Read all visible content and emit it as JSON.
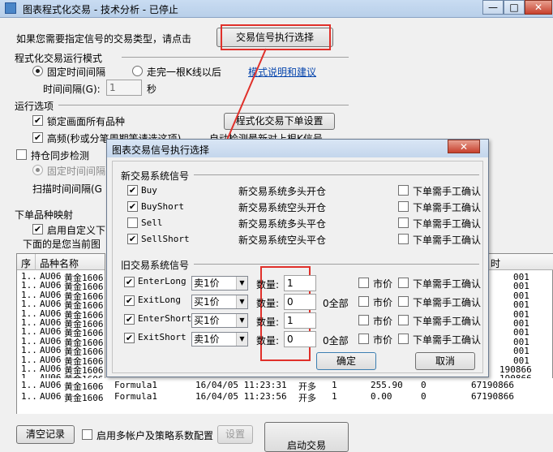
{
  "window": {
    "title": "图表程式化交易 - 技术分析 - 已停止",
    "min": "—",
    "max": "□",
    "close": "✕"
  },
  "signal_type": {
    "prompt": "如果您需要指定信号的交易类型，请点击",
    "button": "交易信号执行选择"
  },
  "run_mode": {
    "title": "程式化交易运行模式",
    "fixed": "固定时间间隔",
    "after_k": "走完一根K线以后",
    "interval_label": "时间间隔(G):",
    "interval_value": "1",
    "unit": "秒",
    "link": "模式说明和建议"
  },
  "run_options": {
    "title": "运行选项",
    "lock": "锁定画面所有品种",
    "setup_button": "程式化交易下单设置",
    "hf": "高频(秒或分笔周期等请选这项)",
    "auto": "自动检测最新对上根K信号",
    "sync": "持仓同步检测",
    "fixed": "固定时间间隔",
    "scan": "扫描时间间隔(G"
  },
  "mapping": {
    "title": "下单品种映射",
    "custom": "启用自定义下",
    "below": "下面的是您当前图"
  },
  "table": {
    "headers": [
      "序",
      "品种名称",
      "",
      "",
      "",
      "",
      "",
      "",
      "",
      "时"
    ],
    "head_right": "时",
    "rows": [
      {
        "n": "1..",
        "code": "AU06",
        "name": "黄金1606",
        "tail": "001"
      },
      {
        "n": "1..",
        "code": "AU06",
        "name": "黄金1606",
        "tail": "001"
      },
      {
        "n": "1..",
        "code": "AU06",
        "name": "黄金1606",
        "tail": "001"
      },
      {
        "n": "1..",
        "code": "AU06",
        "name": "黄金1606",
        "tail": "001"
      },
      {
        "n": "1..",
        "code": "AU06",
        "name": "黄金1606",
        "tail": "001"
      },
      {
        "n": "1..",
        "code": "AU06",
        "name": "黄金1606",
        "tail": "001"
      },
      {
        "n": "1..",
        "code": "AU06",
        "name": "黄金1606",
        "tail": "001"
      },
      {
        "n": "1..",
        "code": "AU06",
        "name": "黄金1606",
        "tail": "001"
      },
      {
        "n": "1..",
        "code": "AU06",
        "name": "黄金1606",
        "tail": "001"
      },
      {
        "n": "1..",
        "code": "AU06",
        "name": "黄金1606",
        "tail": "001"
      },
      {
        "n": "1..",
        "code": "AU06",
        "name": "黄金1606",
        "tail": "190866"
      },
      {
        "n": "1..",
        "code": "AU06",
        "name": "黄金1606",
        "tail": "190866"
      },
      {
        "n": "1..",
        "code": "AU06",
        "name": "黄金1606",
        "tail": "67190866"
      }
    ],
    "full_rows": [
      {
        "n": "1..",
        "code": "AU06",
        "name": "黄金1606",
        "formula": "Formula1",
        "time": "16/04/05 11:23:31",
        "act": "开多",
        "qty": "1",
        "price": "255.90",
        "z": "0",
        "acct": "67190866"
      },
      {
        "n": "1..",
        "code": "AU06",
        "name": "黄金1606",
        "formula": "Formula1",
        "time": "16/04/05 11:23:56",
        "act": "开多",
        "qty": "1",
        "price": "0.00",
        "z": "0",
        "acct": "67190866"
      }
    ],
    "row_prefix": ""
  },
  "bottom": {
    "clear": "清空记录",
    "multi": "启用多帐户及策略系数配置",
    "settings": "设置",
    "start": "启动交易"
  },
  "dialog": {
    "title": "图表交易信号执行选择",
    "close": "✕",
    "new_title": "新交易系统信号",
    "new_signals": [
      {
        "name": "Buy",
        "checked": true,
        "desc": "新交易系统多头开仓",
        "manual": "下单需手工确认"
      },
      {
        "name": "BuyShort",
        "checked": true,
        "desc": "新交易系统空头开仓",
        "manual": "下单需手工确认"
      },
      {
        "name": "Sell",
        "checked": false,
        "desc": "新交易系统多头平仓",
        "manual": "下单需手工确认"
      },
      {
        "name": "SellShort",
        "checked": true,
        "desc": "新交易系统空头平仓",
        "manual": "下单需手工确认"
      }
    ],
    "old_title": "旧交易系统信号",
    "old_signals": [
      {
        "name": "EnterLong",
        "price": "卖1价",
        "qty_label": "数量:",
        "qty": "1",
        "all": "",
        "market": "市价",
        "manual": "下单需手工确认"
      },
      {
        "name": "ExitLong",
        "price": "买1价",
        "qty_label": "数量:",
        "qty": "0",
        "all": "0全部",
        "market": "市价",
        "manual": "下单需手工确认"
      },
      {
        "name": "EnterShort",
        "price": "买1价",
        "qty_label": "数量:",
        "qty": "1",
        "all": "",
        "market": "市价",
        "manual": "下单需手工确认"
      },
      {
        "name": "ExitShort",
        "price": "卖1价",
        "qty_label": "数量:",
        "qty": "0",
        "all": "0全部",
        "market": "市价",
        "manual": "下单需手工确认"
      }
    ],
    "ok": "确定",
    "cancel": "取消"
  }
}
